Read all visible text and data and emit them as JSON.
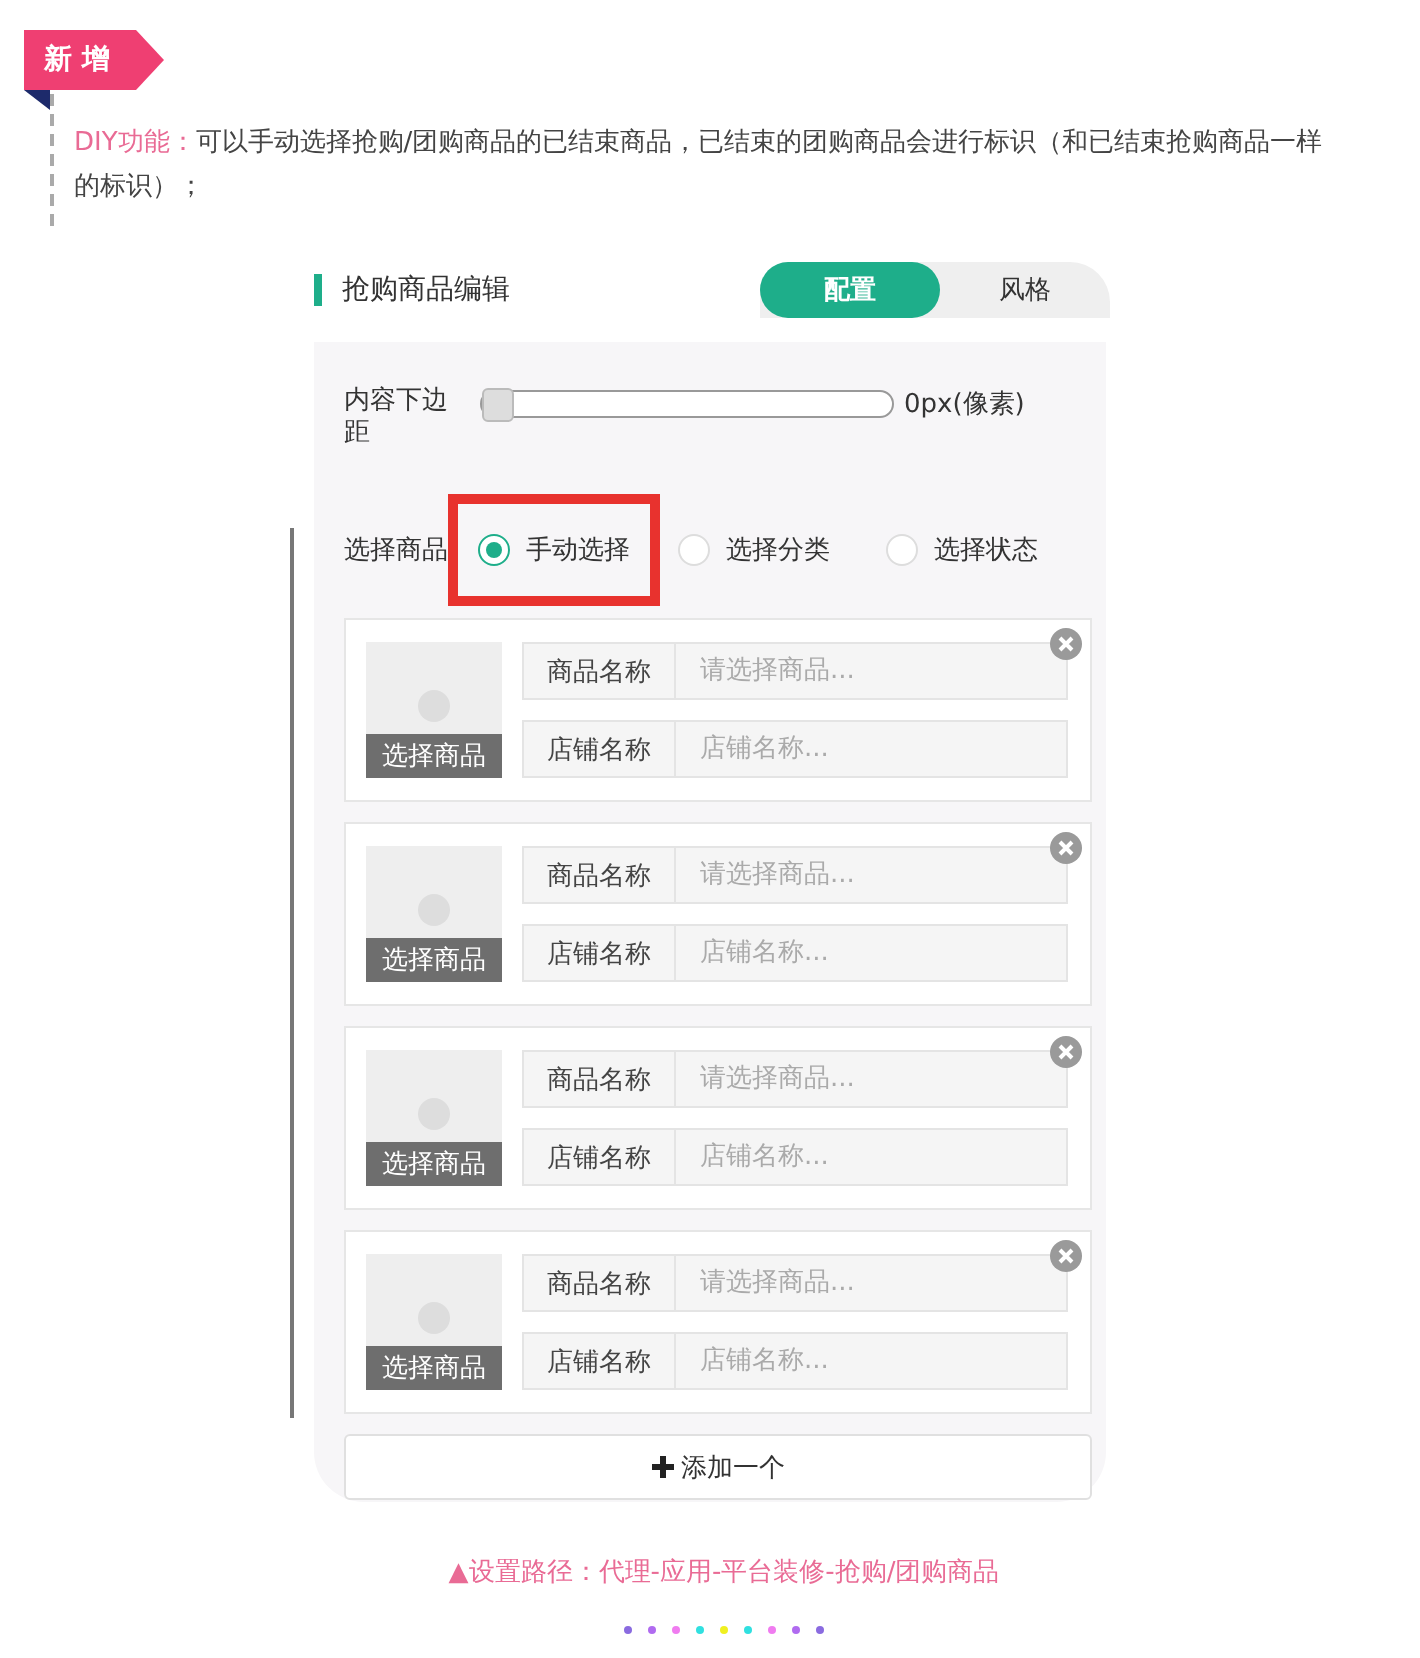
{
  "tag": {
    "label": "新 增"
  },
  "description": {
    "lead": "DIY功能：",
    "text": "可以手动选择抢购/团购商品的已结束商品，已结束的团购商品会进行标识（和已结束抢购商品一样的标识）；"
  },
  "panel": {
    "title": "抢购商品编辑",
    "tabs": [
      {
        "label": "配置",
        "selected": true
      },
      {
        "label": "风格",
        "selected": false
      }
    ],
    "margin_setting": {
      "label": "内容下边距",
      "level": 0,
      "reading": "0px(像素)"
    },
    "select_goods": {
      "label": "选择商品",
      "options": [
        {
          "label": "手动选择",
          "selected": true,
          "highlighted": true
        },
        {
          "label": "选择分类",
          "selected": false,
          "highlighted": false
        },
        {
          "label": "选择状态",
          "selected": false,
          "highlighted": false
        }
      ]
    },
    "items": [
      {
        "image_button": "选择商品",
        "fields": [
          {
            "label": "商品名称",
            "placeholder": "请选择商品..."
          },
          {
            "label": "店铺名称",
            "placeholder": "店铺名称..."
          }
        ]
      },
      {
        "image_button": "选择商品",
        "fields": [
          {
            "label": "商品名称",
            "placeholder": "请选择商品..."
          },
          {
            "label": "店铺名称",
            "placeholder": "店铺名称..."
          }
        ]
      },
      {
        "image_button": "选择商品",
        "fields": [
          {
            "label": "商品名称",
            "placeholder": "请选择商品..."
          },
          {
            "label": "店铺名称",
            "placeholder": "店铺名称..."
          }
        ]
      },
      {
        "image_button": "选择商品",
        "fields": [
          {
            "label": "商品名称",
            "placeholder": "请选择商品..."
          },
          {
            "label": "店铺名称",
            "placeholder": "店铺名称..."
          }
        ]
      }
    ],
    "add_button": "添加一个"
  },
  "caption": "▲设置路径：代理-应用-平台装修-抢购/团购商品",
  "dots": [
    {
      "color": "#8a6be0"
    },
    {
      "color": "#b06bf0"
    },
    {
      "color": "#f07cf0"
    },
    {
      "color": "#30e0e0"
    },
    {
      "color": "#f0f020"
    },
    {
      "color": "#30e0e0"
    },
    {
      "color": "#f07cf0"
    },
    {
      "color": "#b06bf0"
    },
    {
      "color": "#8a6be0"
    }
  ]
}
